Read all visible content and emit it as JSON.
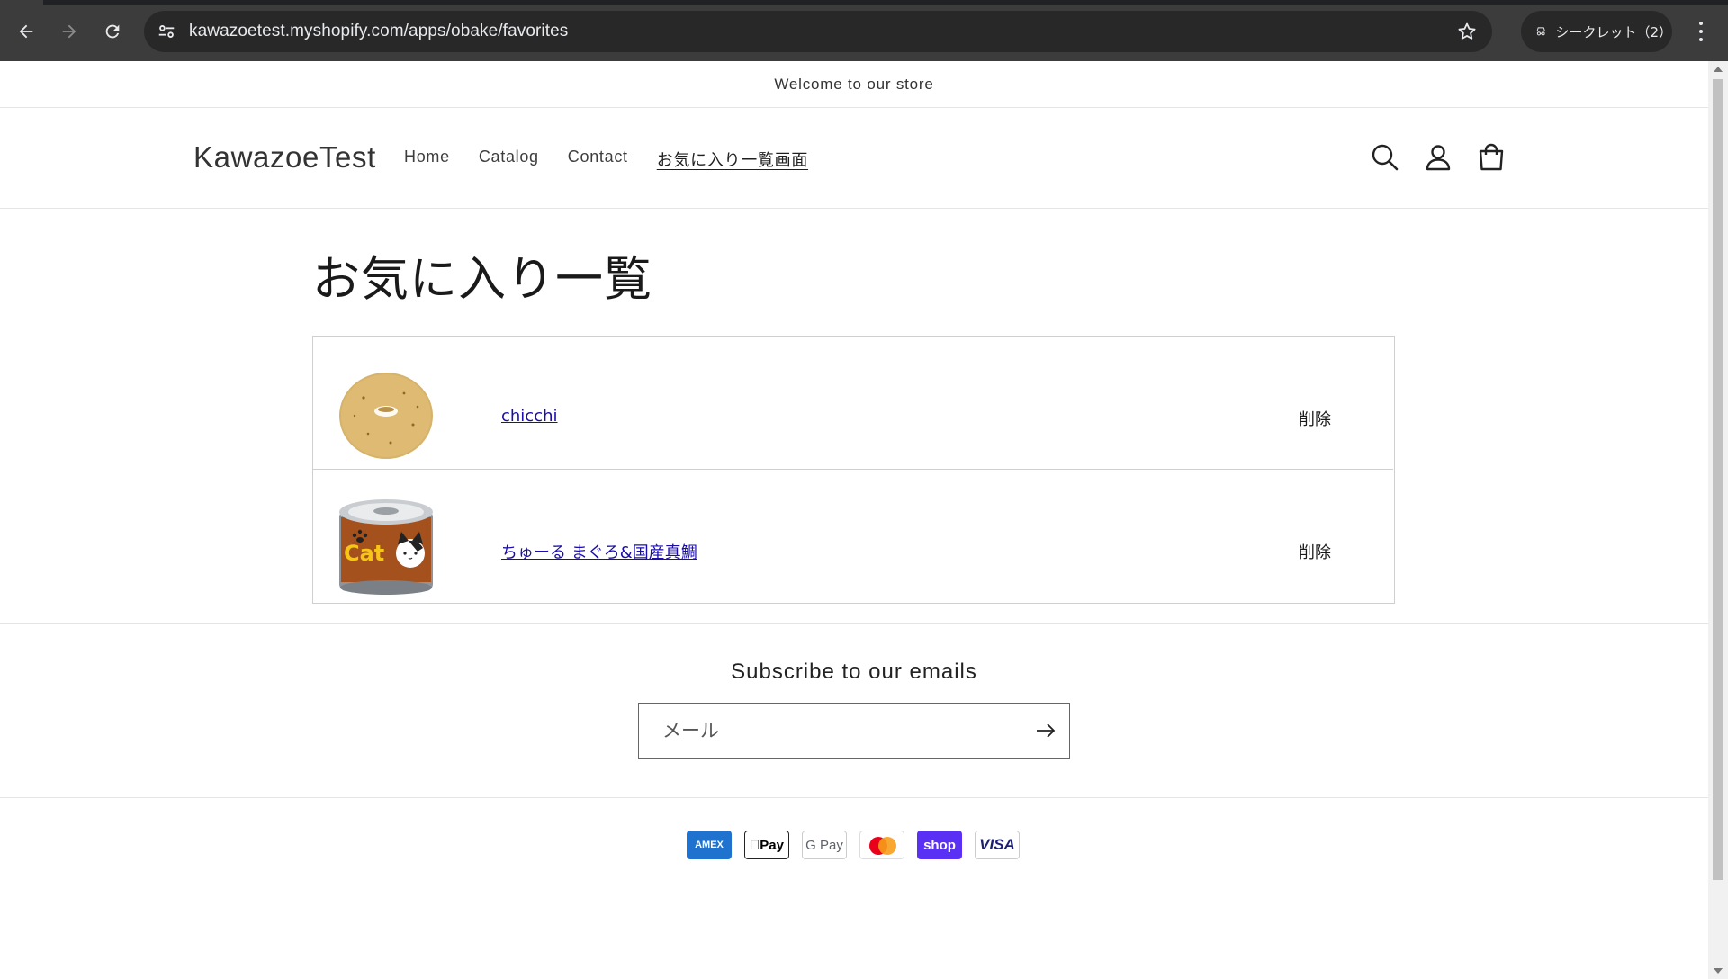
{
  "browser": {
    "url": "kawazoetest.myshopify.com/apps/obake/favorites",
    "incognito_label": "シークレット（2）"
  },
  "announcement": "Welcome to our store",
  "header": {
    "logo": "KawazoeTest",
    "nav": [
      "Home",
      "Catalog",
      "Contact",
      "お気に入り一覧画面"
    ],
    "active_nav_index": 3
  },
  "page": {
    "title": "お気に入り一覧",
    "favorites": [
      {
        "name": "chicchi",
        "delete_label": "削除",
        "image": "donut-image"
      },
      {
        "name": "ちゅーる まぐろ&国産真鯛",
        "delete_label": "削除",
        "image": "cat-food-can-image"
      }
    ]
  },
  "newsletter": {
    "title": "Subscribe to our emails",
    "placeholder": "メール"
  },
  "payment_methods": [
    "AMEX",
    "Pay",
    "G Pay",
    "mastercard",
    "shop",
    "VISA"
  ],
  "colors": {
    "chrome_bg": "#3c3c3c",
    "link": "#1a0dab",
    "shop_pay": "#5a31f4",
    "amex": "#1f72cd"
  }
}
